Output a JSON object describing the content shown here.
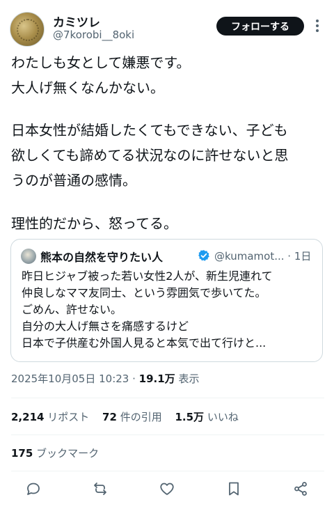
{
  "author": {
    "display_name": "カミツレ",
    "handle": "@7korobi__8oki",
    "follow_label": "フォローする"
  },
  "post": {
    "lines": [
      "わたしも女として嫌悪です。",
      "大人げ無くなんかない。",
      "日本女性が結婚したくてもできない、子ども",
      "欲しくても諦めてる状況なのに許せないと思",
      "うのが普通の感情。",
      "理性的だから、怒ってる。"
    ]
  },
  "quoted": {
    "display_name": "熊本の自然を守りたい人",
    "handle_time": "@kumamot... · 1日",
    "lines": [
      "昨日ヒジャブ被った若い女性2人が、新生児連れて",
      "仲良しなママ友同士、という雰囲気で歩いてた。",
      "ごめん、許せない。",
      "自分の大人げ無さを痛感するけど",
      "日本で子供産む外国人見ると本気で出て行けと..."
    ]
  },
  "meta": {
    "timestamp": "2025年10月05日 10:23 · ",
    "views_count": "19.1万",
    "views_label": " 表示"
  },
  "stats": {
    "reposts_count": "2,214",
    "reposts_label": "リポスト",
    "quotes_count": "72",
    "quotes_label": "件の引用",
    "likes_count": "1.5万",
    "likes_label": "いいね",
    "bookmarks_count": "175",
    "bookmarks_label": "ブックマーク"
  },
  "colors": {
    "text": "#0f1419",
    "secondary": "#536471",
    "verified": "#1d9bf0",
    "divider": "#eff3f4"
  }
}
